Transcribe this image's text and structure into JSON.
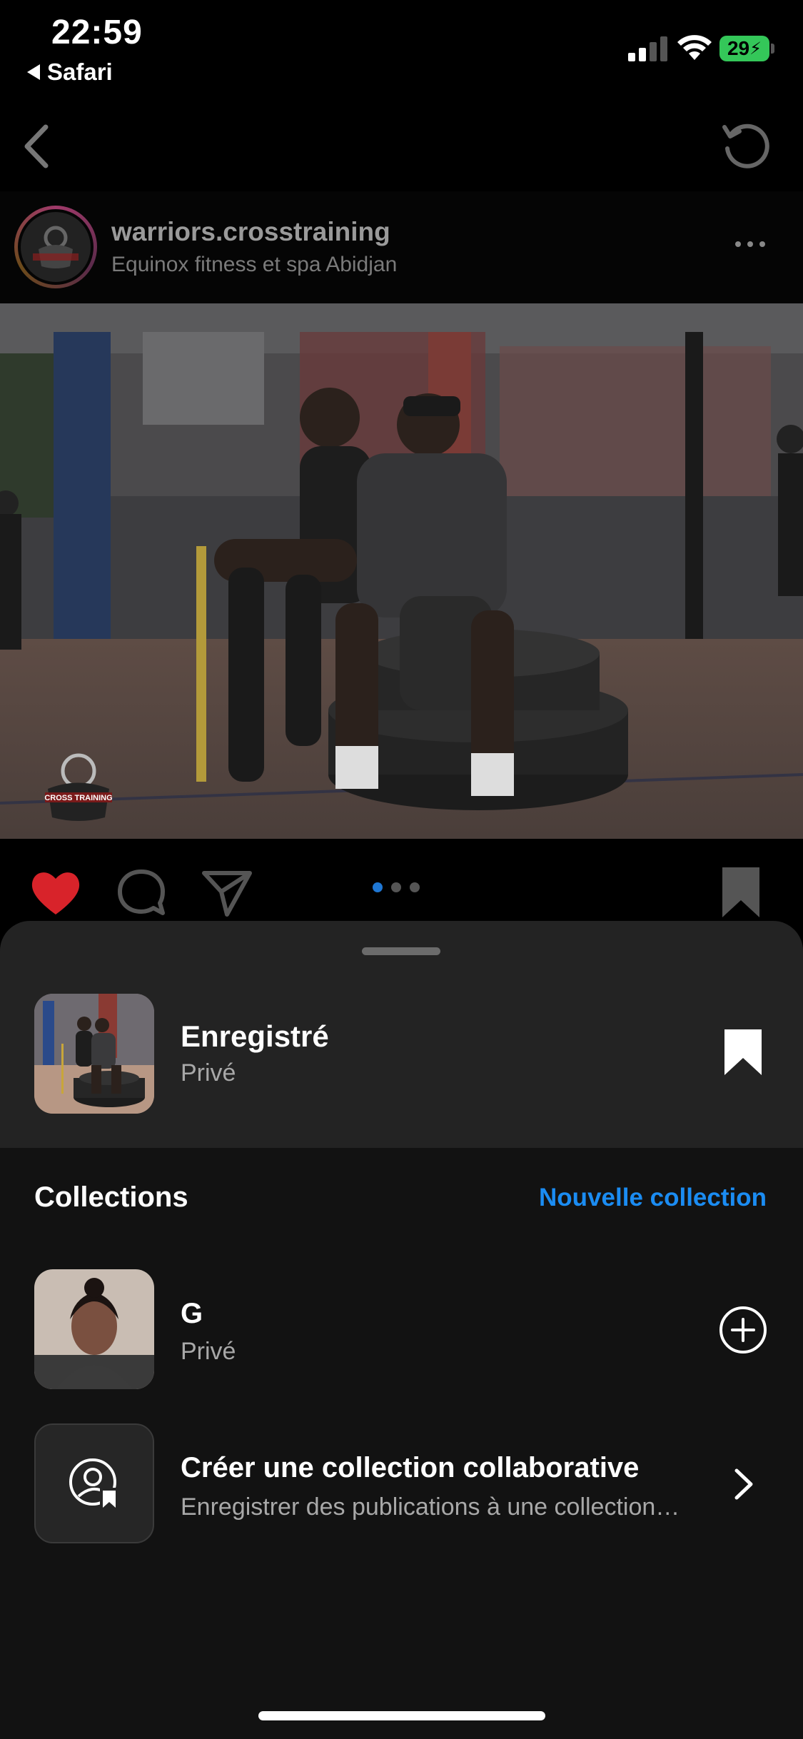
{
  "status_bar": {
    "time": "22:59",
    "back_app": "Safari",
    "battery": "29",
    "icons": [
      "signal-icon",
      "wifi-icon",
      "battery-charging-icon"
    ]
  },
  "nav": {
    "icons": [
      "chevron-left-icon",
      "refresh-icon"
    ]
  },
  "post": {
    "username": "warriors.crosstraining",
    "location": "Equinox fitness et spa Abidjan",
    "avatar_logo_text": "CROSS TRAINING",
    "carousel_count": 3,
    "carousel_active": 1,
    "liked": true,
    "icons": [
      "heart-icon",
      "comment-icon",
      "share-icon",
      "bookmark-icon"
    ]
  },
  "sheet": {
    "saved": {
      "title": "Enregistré",
      "subtitle": "Privé"
    },
    "collections_label": "Collections",
    "new_collection_label": "Nouvelle collection",
    "items": [
      {
        "name": "G",
        "subtitle": "Privé"
      }
    ],
    "collab": {
      "title": "Créer une collection collaborative",
      "subtitle": "Enregistrer des publications à une collection partagée"
    }
  },
  "colors": {
    "accent": "#1b8cf2",
    "like": "#d8232a",
    "battery": "#34c759",
    "sheet_bg": "#121212",
    "sheet_top_bg": "#232323"
  }
}
